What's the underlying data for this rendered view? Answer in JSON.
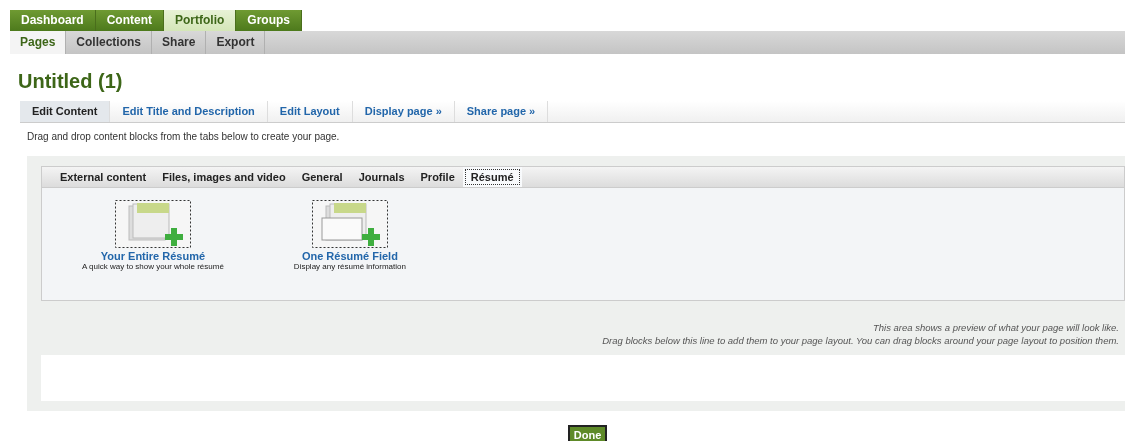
{
  "main_nav": [
    {
      "label": "Dashboard",
      "selected": false
    },
    {
      "label": "Content",
      "selected": false
    },
    {
      "label": "Portfolio",
      "selected": true
    },
    {
      "label": "Groups",
      "selected": false
    }
  ],
  "sub_nav": [
    {
      "label": "Pages",
      "selected": true
    },
    {
      "label": "Collections",
      "selected": false
    },
    {
      "label": "Share",
      "selected": false
    },
    {
      "label": "Export",
      "selected": false
    }
  ],
  "page_title": "Untitled (1)",
  "edit_tabs": [
    {
      "label": "Edit Content",
      "selected": true
    },
    {
      "label": "Edit Title and Description",
      "selected": false
    },
    {
      "label": "Edit Layout",
      "selected": false
    },
    {
      "label": "Display page »",
      "selected": false
    },
    {
      "label": "Share page »",
      "selected": false
    }
  ],
  "instructions": "Drag and drop content blocks from the tabs below to create your page.",
  "block_tabs": [
    {
      "label": "External content",
      "selected": false
    },
    {
      "label": "Files, images and video",
      "selected": false
    },
    {
      "label": "General",
      "selected": false
    },
    {
      "label": "Journals",
      "selected": false
    },
    {
      "label": "Profile",
      "selected": false
    },
    {
      "label": "Résumé",
      "selected": true
    }
  ],
  "blocks": [
    {
      "title": "Your Entire Résumé",
      "description": "A quick way to show your whole résumé"
    },
    {
      "title": "One Résumé Field",
      "description": "Display any résumé information"
    }
  ],
  "preview_notes": [
    "This area shows a preview of what your page will look like.",
    "Drag blocks below this line to add them to your page layout. You can drag blocks around your page layout to position them."
  ],
  "done_button": "Done"
}
